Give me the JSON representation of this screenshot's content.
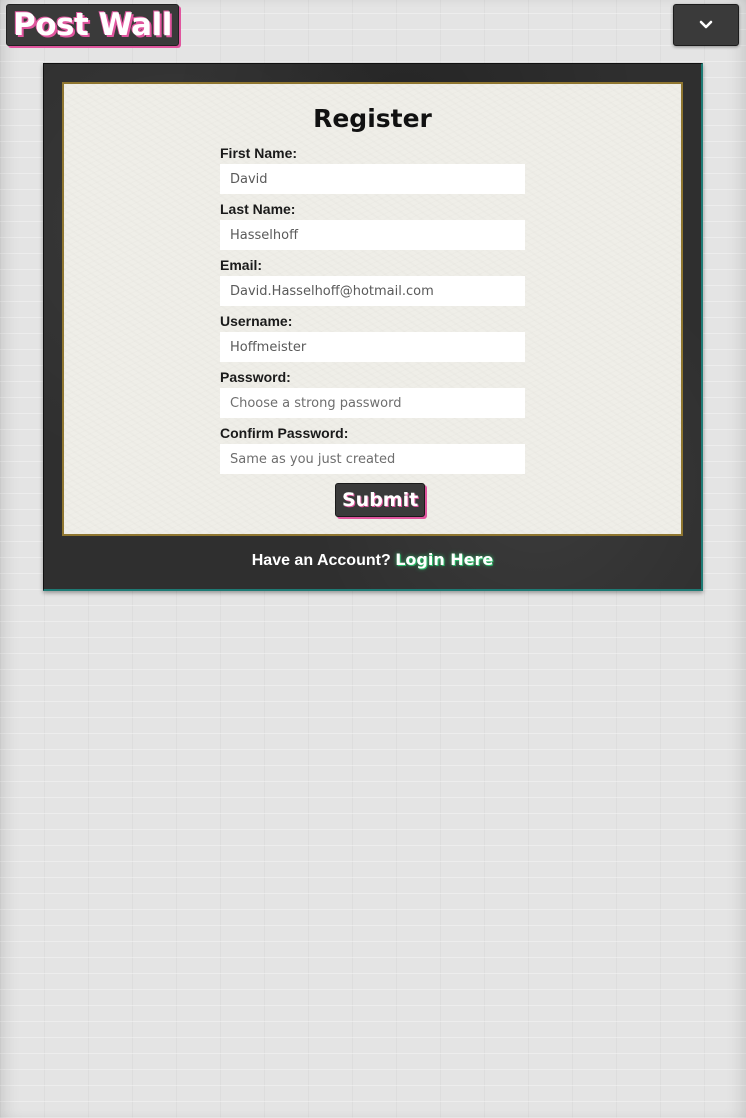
{
  "header": {
    "brand": "Post Wall",
    "menu_icon": "chevron-down-icon"
  },
  "form": {
    "title": "Register",
    "fields": [
      {
        "label": "First Name:",
        "value": "David",
        "placeholder": ""
      },
      {
        "label": "Last Name:",
        "value": "Hasselhoff",
        "placeholder": ""
      },
      {
        "label": "Email:",
        "value": "David.Hasselhoff@hotmail.com",
        "placeholder": ""
      },
      {
        "label": "Username:",
        "value": "Hoffmeister",
        "placeholder": ""
      },
      {
        "label": "Password:",
        "value": "",
        "placeholder": "Choose a strong password"
      },
      {
        "label": "Confirm Password:",
        "value": "",
        "placeholder": "Same as you just created"
      }
    ],
    "submit_label": "Submit"
  },
  "footer": {
    "prompt": "Have an Account?",
    "login_link": "Login Here"
  },
  "colors": {
    "accent_pink": "#e0559e",
    "board_dark": "#2f2f2f",
    "paper": "#efeee8",
    "frame_gold": "#8f7630",
    "link_glow_green": "#2dbb6a",
    "board_edge_teal": "#1e7a74"
  }
}
